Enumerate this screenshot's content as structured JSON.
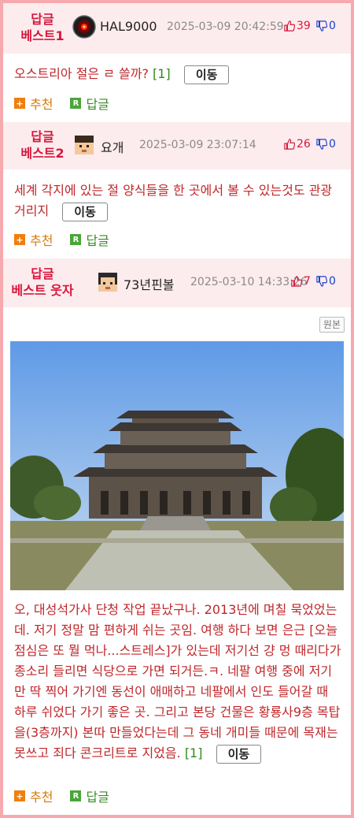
{
  "comments": [
    {
      "best_label_line1": "답글",
      "best_label_line2": "베스트1",
      "nickname": "HAL9000",
      "avatar_icon": "hal9000-eye-icon",
      "date": "2025-03-09 20:42:59",
      "likes": "39",
      "dislikes": "0",
      "content": "오스트리아 절은 ㄹ 쓸까?",
      "reply_count": "[1]",
      "move_label": "이동",
      "recommend_label": "추천",
      "reply_label": "답글"
    },
    {
      "best_label_line1": "답글",
      "best_label_line2": "베스트2",
      "nickname": "요개",
      "avatar_icon": "pixel-face-icon",
      "date": "2025-03-09 23:07:14",
      "likes": "26",
      "dislikes": "0",
      "content": "세계 각지에 있는 절 양식들을 한 곳에서 볼 수 있는것도 관광거리지",
      "move_label": "이동",
      "recommend_label": "추천",
      "reply_label": "답글"
    },
    {
      "best_label_line1": "답글",
      "best_label_line2": "베스트 웃자",
      "nickname": "73년핀볼",
      "avatar_icon": "pixel-face-icon",
      "date": "2025-03-10 14:33:26",
      "likes": "7",
      "dislikes": "0",
      "original_label": "원본",
      "content": "오, 대성석가사 단청 작업 끝났구나. 2013년에 며칠 묵었었는데. 저기 정말 맘 편하게 쉬는 곳임. 여행 하다 보면 은근 [오늘 점심은 또 뭘 먹나...스트레스]가 있는데 저기선 걍 멍 때리다가 종소리 들리면 식당으로 가면 되거든.ㅋ. 네팔 여행 중에 저기만 딱 찍어 가기엔 동선이 애매하고 네팔에서 인도 들어갈 때 하루 쉬었다 가기 좋은 곳. 그리고 본당 건물은 황룡사9층 목탑을(3층까지) 본따 만들었다는데 그 동네 개미들 때문에 목재는 못쓰고 죄다 콘크리트로 지었음.",
      "reply_count": "[1]",
      "move_label": "이동",
      "recommend_label": "추천",
      "reply_label": "답글"
    }
  ],
  "colors": {
    "accent_red": "#d6173c",
    "content_red": "#c0262a",
    "like_red": "#d6173c",
    "dislike_blue": "#1a3fc9",
    "header_bg": "#fdecee",
    "border_pink": "#f6a9ae"
  }
}
